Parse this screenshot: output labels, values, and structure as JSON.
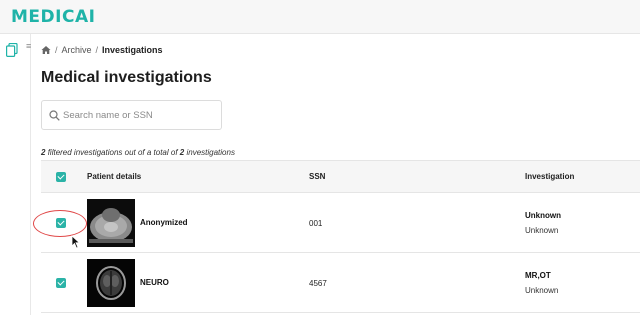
{
  "app": {
    "logo_text": "MEDICAI",
    "brand_color": "#1fb3a8"
  },
  "sidebar": {
    "icon": "copy-icon",
    "collapse_icon": "menu-icon"
  },
  "breadcrumb": {
    "home_icon": "home-icon",
    "separator": "/",
    "archive": "Archive",
    "current": "Investigations"
  },
  "page": {
    "title": "Medical investigations"
  },
  "search": {
    "placeholder": "Search name or SSN",
    "value": ""
  },
  "summary": {
    "count": "2",
    "text_mid": "filtered investigations out of a total of",
    "total": "2",
    "text_end": "investigations"
  },
  "table": {
    "headers": {
      "patient": "Patient details",
      "ssn": "SSN",
      "investigation": "Investigation"
    },
    "header_checked": true,
    "rows": [
      {
        "checked": true,
        "name": "Anonymized",
        "ssn": "001",
        "investigation_primary": "Unknown",
        "investigation_secondary": "Unknown",
        "thumbnail": "ct-scan-thumbnail"
      },
      {
        "checked": true,
        "name": "NEURO",
        "ssn": "4567",
        "investigation_primary": "MR,OT",
        "investigation_secondary": "Unknown",
        "thumbnail": "mri-brain-thumbnail"
      }
    ]
  }
}
